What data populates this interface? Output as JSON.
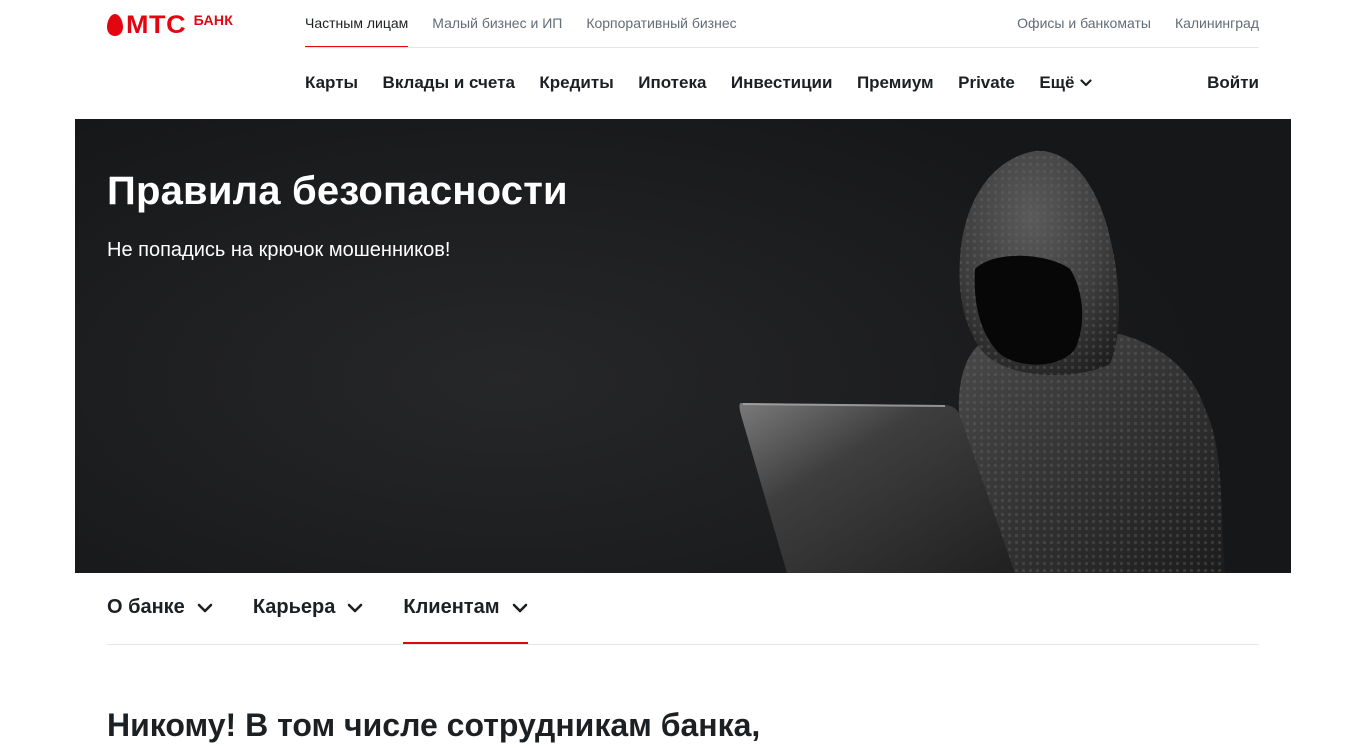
{
  "brand": {
    "name": "МТС",
    "suffix": "БАНК",
    "accent": "#e30611"
  },
  "segments": [
    {
      "label": "Частным лицам",
      "active": true
    },
    {
      "label": "Малый бизнес и ИП",
      "active": false
    },
    {
      "label": "Корпоративный бизнес",
      "active": false
    }
  ],
  "top_right": {
    "offices": "Офисы и банкоматы",
    "city": "Калининград"
  },
  "main_nav": {
    "items": [
      "Карты",
      "Вклады и счета",
      "Кредиты",
      "Ипотека",
      "Инвестиции",
      "Премиум",
      "Private"
    ],
    "more": "Ещё",
    "login": "Войти"
  },
  "hero": {
    "title": "Правила безопасности",
    "subtitle": "Не попадись на крючок мошенников!"
  },
  "sub_nav": [
    {
      "label": "О банке",
      "active": false
    },
    {
      "label": "Карьера",
      "active": false
    },
    {
      "label": "Клиентам",
      "active": true
    }
  ],
  "section": {
    "title": "Никому! В том числе сотрудникам банка,"
  },
  "icons": {
    "more": "chevron-down-icon",
    "subnav": "chevron-down-icon",
    "logo": "mts-egg-logo"
  }
}
